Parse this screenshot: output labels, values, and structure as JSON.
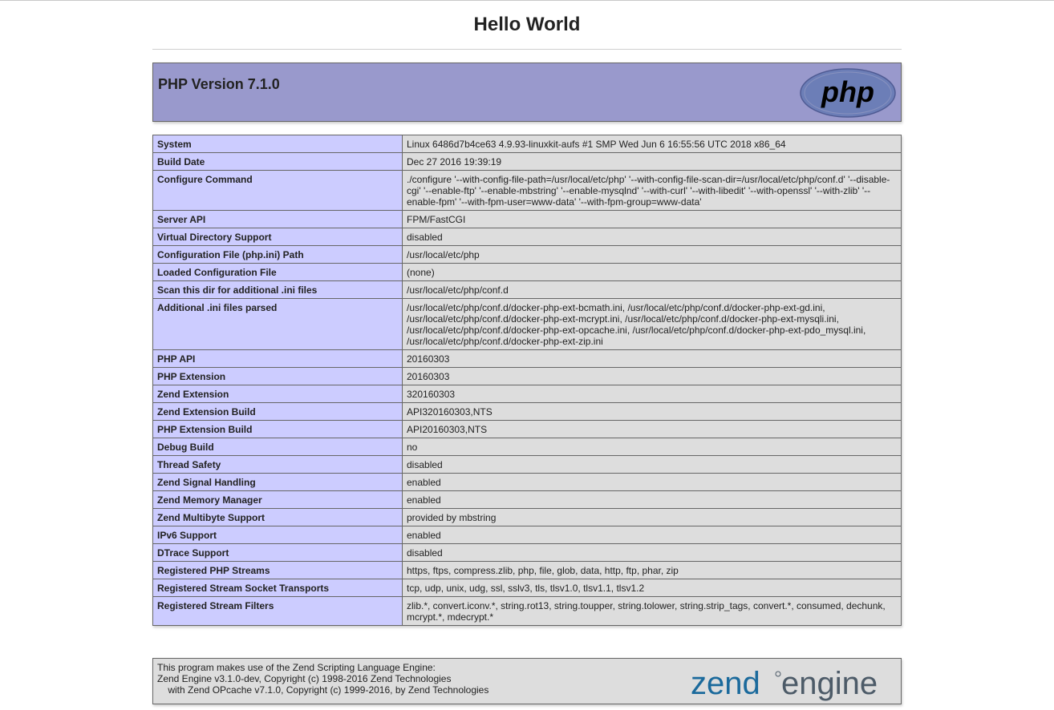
{
  "page": {
    "heading": "Hello World"
  },
  "header": {
    "version_title": "PHP Version 7.1.0",
    "logo_text": "php",
    "colors": {
      "header_bg": "#9999cc",
      "key_bg": "#ccccff",
      "value_bg": "#dddddd",
      "border": "#666666"
    }
  },
  "info": {
    "rows": [
      {
        "key": "System",
        "value": "Linux 6486d7b4ce63 4.9.93-linuxkit-aufs #1 SMP Wed Jun 6 16:55:56 UTC 2018 x86_64"
      },
      {
        "key": "Build Date",
        "value": "Dec 27 2016 19:39:19"
      },
      {
        "key": "Configure Command",
        "value": "./configure  '--with-config-file-path=/usr/local/etc/php' '--with-config-file-scan-dir=/usr/local/etc/php/conf.d' '--disable-cgi' '--enable-ftp' '--enable-mbstring' '--enable-mysqlnd' '--with-curl' '--with-libedit' '--with-openssl' '--with-zlib' '--enable-fpm' '--with-fpm-user=www-data' '--with-fpm-group=www-data'"
      },
      {
        "key": "Server API",
        "value": "FPM/FastCGI"
      },
      {
        "key": "Virtual Directory Support",
        "value": "disabled"
      },
      {
        "key": "Configuration File (php.ini) Path",
        "value": "/usr/local/etc/php"
      },
      {
        "key": "Loaded Configuration File",
        "value": "(none)"
      },
      {
        "key": "Scan this dir for additional .ini files",
        "value": "/usr/local/etc/php/conf.d"
      },
      {
        "key": "Additional .ini files parsed",
        "value": "/usr/local/etc/php/conf.d/docker-php-ext-bcmath.ini, /usr/local/etc/php/conf.d/docker-php-ext-gd.ini, /usr/local/etc/php/conf.d/docker-php-ext-mcrypt.ini, /usr/local/etc/php/conf.d/docker-php-ext-mysqli.ini, /usr/local/etc/php/conf.d/docker-php-ext-opcache.ini, /usr/local/etc/php/conf.d/docker-php-ext-pdo_mysql.ini, /usr/local/etc/php/conf.d/docker-php-ext-zip.ini"
      },
      {
        "key": "PHP API",
        "value": "20160303"
      },
      {
        "key": "PHP Extension",
        "value": "20160303"
      },
      {
        "key": "Zend Extension",
        "value": "320160303"
      },
      {
        "key": "Zend Extension Build",
        "value": "API320160303,NTS"
      },
      {
        "key": "PHP Extension Build",
        "value": "API20160303,NTS"
      },
      {
        "key": "Debug Build",
        "value": "no"
      },
      {
        "key": "Thread Safety",
        "value": "disabled"
      },
      {
        "key": "Zend Signal Handling",
        "value": "enabled"
      },
      {
        "key": "Zend Memory Manager",
        "value": "enabled"
      },
      {
        "key": "Zend Multibyte Support",
        "value": "provided by mbstring"
      },
      {
        "key": "IPv6 Support",
        "value": "enabled"
      },
      {
        "key": "DTrace Support",
        "value": "disabled"
      },
      {
        "key": "Registered PHP Streams",
        "value": "https, ftps, compress.zlib, php, file, glob, data, http, ftp, phar, zip"
      },
      {
        "key": "Registered Stream Socket Transports",
        "value": "tcp, udp, unix, udg, ssl, sslv3, tls, tlsv1.0, tlsv1.1, tlsv1.2"
      },
      {
        "key": "Registered Stream Filters",
        "value": "zlib.*, convert.iconv.*, string.rot13, string.toupper, string.tolower, string.strip_tags, convert.*, consumed, dechunk, mcrypt.*, mdecrypt.*"
      }
    ]
  },
  "zend": {
    "text": "This program makes use of the Zend Scripting Language Engine:\nZend Engine v3.1.0-dev, Copyright (c) 1998-2016 Zend Technologies\n    with Zend OPcache v7.1.0, Copyright (c) 1999-2016, by Zend Technologies",
    "logo_word1": "zend",
    "logo_word2": "engine",
    "logo_color1": "#1b6a9c",
    "logo_color2": "#4d5b68"
  }
}
